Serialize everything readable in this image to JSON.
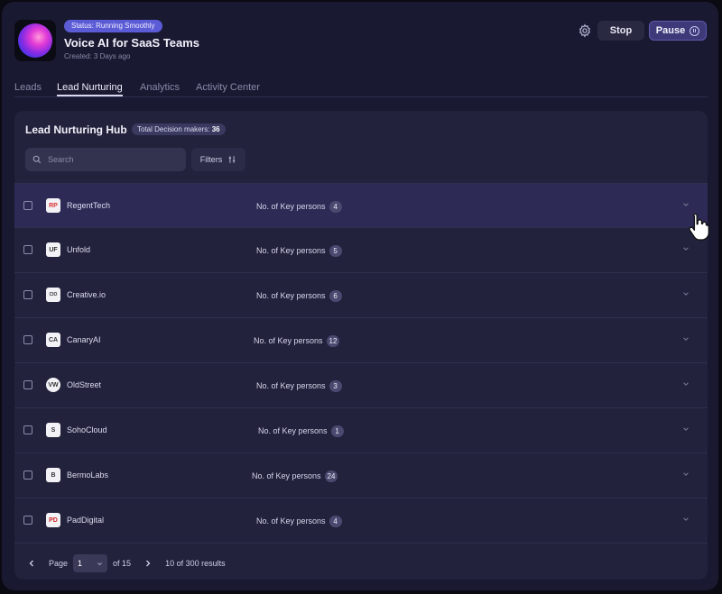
{
  "header": {
    "status": "Status: Running Smoothly",
    "title": "Voice AI for SaaS Teams",
    "created": "Created: 3 Days ago",
    "stop_label": "Stop",
    "pause_label": "Pause",
    "icons": [
      "gear-icon",
      "pause-circle-icon"
    ]
  },
  "tabs": [
    {
      "label": "Leads",
      "active": false
    },
    {
      "label": "Lead Nurturing",
      "active": true
    },
    {
      "label": "Analytics",
      "active": false
    },
    {
      "label": "Activity Center",
      "active": false
    }
  ],
  "hub": {
    "title": "Lead Nurturing Hub",
    "count_label": "Total Decision makers:",
    "count_value": "36",
    "search_placeholder": "Search",
    "filters_label": "Filters"
  },
  "rows": [
    {
      "company": "RegentTech",
      "key_label": "No. of Key persons",
      "key_count": "4",
      "logo": "RP",
      "hovered": true
    },
    {
      "company": "Unfold",
      "key_label": "No. of Key persons",
      "key_count": "5",
      "logo": "UF"
    },
    {
      "company": "Creative.io",
      "key_label": "No. of Key persons",
      "key_count": "6",
      "logo": "CIO"
    },
    {
      "company": "CanaryAI",
      "key_label": "No. of Key persons",
      "key_count": "12",
      "logo": "CA"
    },
    {
      "company": "OldStreet",
      "key_label": "No. of Key persons",
      "key_count": "3",
      "logo": "VW"
    },
    {
      "company": "SohoCloud",
      "key_label": "No. of Key persons",
      "key_count": "1",
      "logo": "S"
    },
    {
      "company": "BermoLabs",
      "key_label": "No. of Key persons",
      "key_count": "24",
      "logo": "B"
    },
    {
      "company": "PadDigital",
      "key_label": "No. of Key persons",
      "key_count": "4",
      "logo": "PD"
    }
  ],
  "pager": {
    "page_label": "Page",
    "page_value": "1",
    "of_label": "of 15",
    "results": "10 of 300 results"
  },
  "colors": {
    "background": "#1a1932",
    "panel": "#23223c",
    "accent": "#5b5bd6",
    "row_hover": "#2d2b55"
  }
}
